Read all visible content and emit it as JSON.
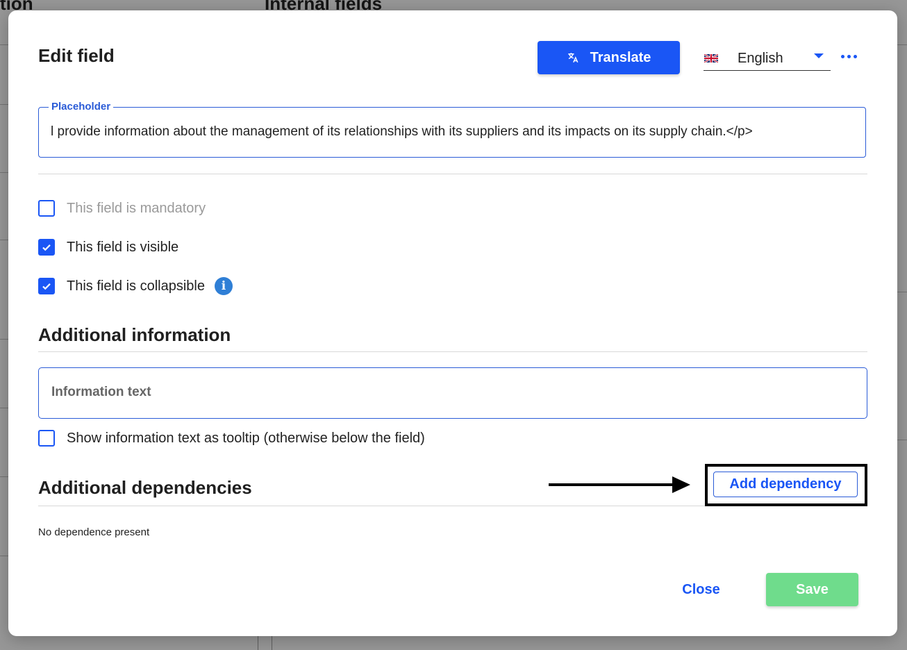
{
  "background": {
    "left_heading": "tion",
    "center_heading": "Internal fields"
  },
  "modal": {
    "title": "Edit field",
    "translate_label": "Translate",
    "language": {
      "selected": "English",
      "flag_icon": "uk-flag-icon"
    },
    "more_icon": "more-horizontal-icon",
    "placeholder_field": {
      "legend": "Placeholder",
      "value": "l provide information about the management of its relationships with its suppliers and its impacts on its supply chain.</p>"
    },
    "checkboxes": [
      {
        "label": "This field is mandatory",
        "checked": false,
        "muted": true
      },
      {
        "label": "This field is visible",
        "checked": true,
        "muted": false
      },
      {
        "label": "This field is collapsible",
        "checked": true,
        "muted": false
      }
    ],
    "additional_information": {
      "title": "Additional information",
      "input_placeholder": "Information text",
      "tooltip_checkbox_label": "Show information text as tooltip (otherwise below the field)",
      "tooltip_checked": false
    },
    "additional_dependencies": {
      "title": "Additional dependencies",
      "add_button_label": "Add dependency",
      "empty_text": "No dependence present"
    },
    "footer": {
      "close_label": "Close",
      "save_label": "Save"
    }
  },
  "colors": {
    "primary": "#1a56f5",
    "save_disabled": "#6fdc8c",
    "info_icon": "#2f7fd6"
  }
}
